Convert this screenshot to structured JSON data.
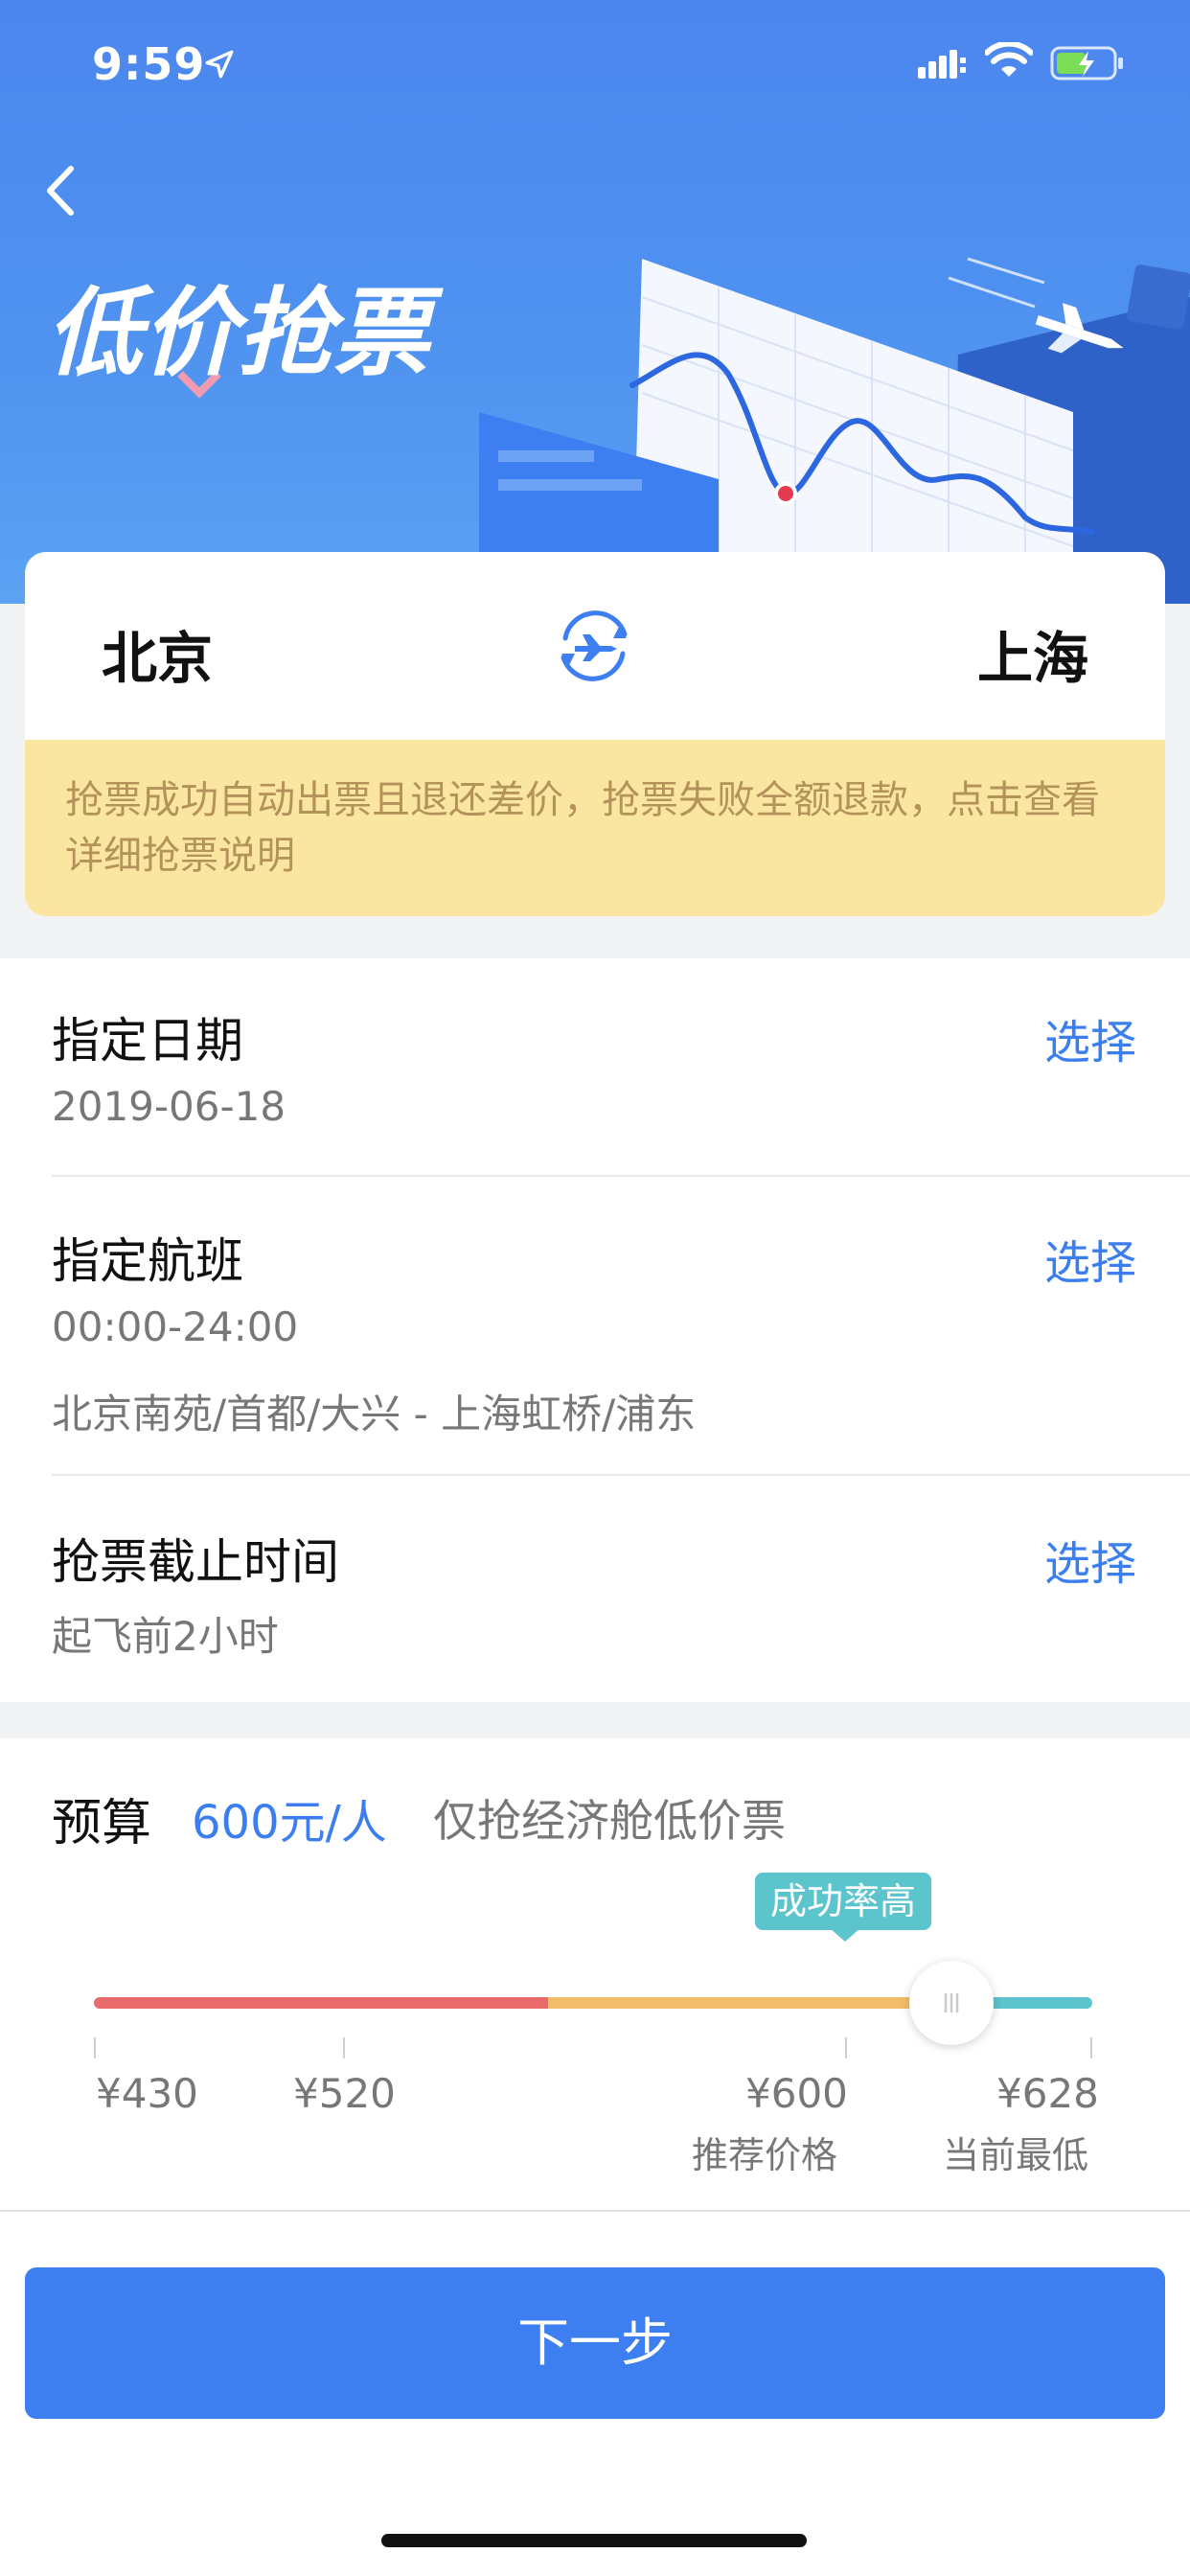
{
  "status_bar": {
    "time": "9:59"
  },
  "hero": {
    "title": "低价抢票"
  },
  "route": {
    "from_city": "北京",
    "to_city": "上海",
    "notice": "抢票成功自动出票且退还差价，抢票失败全额退款，点击查看详细抢票说明"
  },
  "options": {
    "date": {
      "title": "指定日期",
      "value": "2019-06-18",
      "action": "选择"
    },
    "flight": {
      "title": "指定航班",
      "time_range": "00:00-24:00",
      "airports": "北京南苑/首都/大兴 - 上海虹桥/浦东",
      "action": "选择"
    },
    "deadline": {
      "title": "抢票截止时间",
      "value": "起飞前2小时",
      "action": "选择"
    }
  },
  "budget": {
    "label": "预算",
    "value": "600元/人",
    "hint": "仅抢经济舱低价票",
    "tooltip": "成功率高",
    "min": 430,
    "max": 628,
    "selected": 600,
    "ticks": [
      {
        "label": "¥430",
        "sub": ""
      },
      {
        "label": "¥520",
        "sub": ""
      },
      {
        "label": "¥600",
        "sub": "推荐价格"
      },
      {
        "label": "¥628",
        "sub": "当前最低"
      }
    ],
    "colors": {
      "low": "#e86a6a",
      "mid": "#f1bd6a",
      "high": "#5bc4cd"
    }
  },
  "footer": {
    "next_label": "下一步"
  },
  "colors": {
    "primary": "#3d7ef0",
    "notice_bg": "#fbe6a1",
    "notice_text": "#b4935a"
  }
}
